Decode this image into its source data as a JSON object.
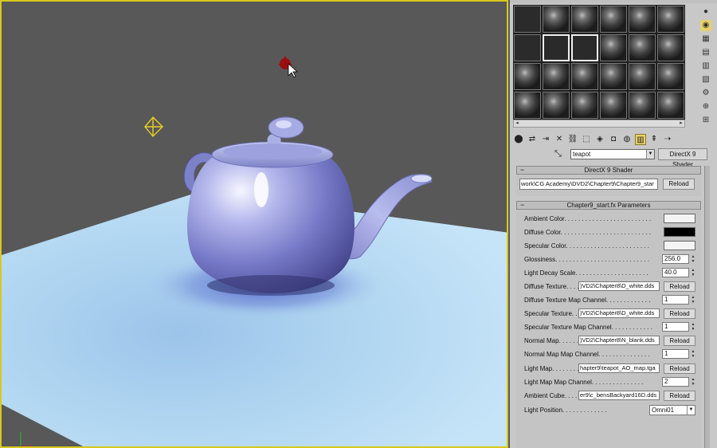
{
  "viewport": {
    "name": "Perspective viewport",
    "border_color": "#d8c81d",
    "background": "#585858"
  },
  "material_editor": {
    "material_name": "teapot",
    "material_type_button": "DirectX 9 Shader",
    "rollouts": {
      "shader": {
        "title": "DirectX 9 Shader",
        "path": "work\\CG Academy\\DVD2\\Chapter9\\Chapter9_star",
        "reload_label": "Reload"
      },
      "params": {
        "title": "Chapter9_start.fx Parameters",
        "ambient_label": "Ambient Color. . . . . . . . . . . . . . . . . . . . . . . . .",
        "diffuse_label": "Diffuse Color. . . . . . . . . . . . . . . . . . . . . . . . . .",
        "specular_label": "Specular Color. . . . . . . . . . . . . . . . . . . . . . . .",
        "glossiness_label": "Glossiness. . . . . . . . . . . . . . . . . . . . . . . . . . .",
        "glossiness_value": "256.0",
        "decay_label": "Light Decay Scale. . . . . . . . . . . . . . . . . . . . .",
        "decay_value": "40.0",
        "diffuse_tex_label": "Diffuse Texture. . . .",
        "diffuse_tex_file": ")VD2\\Chapter8\\D_white.dds",
        "diffuse_ch_label": "Diffuse Texture Map Channel. . . . . . . . . . . . .",
        "diffuse_ch_value": "1",
        "spec_tex_label": "Specular Texture. . .",
        "spec_tex_file": ")VD2\\Chapter8\\D_white.dds",
        "spec_ch_label": "Specular Texture Map Channel. . . . . . . . . . . .",
        "spec_ch_value": "1",
        "normal_label": "Normal Map. . . . . . . .",
        "normal_file": ")VD2\\Chapter8\\N_blank.dds",
        "normal_ch_label": "Normal Map Map Channel. . . . . . . . . . . . . . .",
        "normal_ch_value": "1",
        "lightmap_label": "Light Map. . . . . . . . . .",
        "lightmap_file": "hapter9\\teapot_AO_map.tga",
        "lightmap_ch_label": "Light Map Map Channel. . . . . . . . . . . . . . .",
        "lightmap_ch_value": "2",
        "cube_label": "Ambient Cube. . . . . .",
        "cube_file": "er9\\c_bensBackyard16D.dds",
        "lightpos_label": "Light Position. . . . . . . . . . . . .",
        "lightpos_value": "Omni01",
        "reload_label": "Reload"
      }
    }
  },
  "colors": {
    "ambient": "#f4f4f4",
    "diffuse": "#000000",
    "specular": "#f4f4f4"
  }
}
